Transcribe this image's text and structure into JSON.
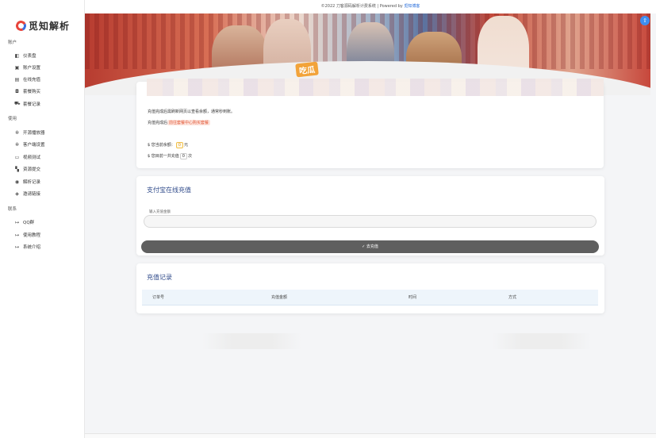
{
  "brand": {
    "name": "觅知解析"
  },
  "topbar": {
    "copyright": "©2022 刀客源码解析计费系统 | Powered by ",
    "powered_link": "觅知博客"
  },
  "sidebar": {
    "groups": [
      {
        "label": "账户",
        "items": [
          {
            "label": "仪表盘",
            "icon": "dashboard-icon",
            "glyph": "◧"
          },
          {
            "label": "账户设置",
            "icon": "user-card-icon",
            "glyph": "▣"
          },
          {
            "label": "在线充值",
            "icon": "card-icon",
            "glyph": "▤"
          },
          {
            "label": "套餐购买",
            "icon": "bag-icon",
            "glyph": "◘"
          },
          {
            "label": "套餐记录",
            "icon": "cart-icon",
            "glyph": "⛟"
          }
        ]
      },
      {
        "label": "使用",
        "items": [
          {
            "label": "开源播放器",
            "icon": "gear-icon",
            "glyph": "✲"
          },
          {
            "label": "客户端设置",
            "icon": "gear-icon",
            "glyph": "✲"
          },
          {
            "label": "视频测试",
            "icon": "monitor-icon",
            "glyph": "▭"
          },
          {
            "label": "资源提交",
            "icon": "book-icon",
            "glyph": "▚"
          },
          {
            "label": "解析记录",
            "icon": "eye-icon",
            "glyph": "◉"
          },
          {
            "label": "邀请链接",
            "icon": "tag-icon",
            "glyph": "◈"
          }
        ]
      },
      {
        "label": "联系",
        "items": [
          {
            "label": "QQ群",
            "icon": "arrow-in-icon",
            "glyph": "↦"
          },
          {
            "label": "使用教程",
            "icon": "arrow-in-icon",
            "glyph": "↦"
          },
          {
            "label": "系统介绍",
            "icon": "arrow-in-icon",
            "glyph": "↦"
          }
        ]
      }
    ]
  },
  "banner": {
    "badge": "吃瓜",
    "accent": "#c7483c"
  },
  "info_card": {
    "line1": "充值完成后需刷新网页以查看余额，通常秒到账。",
    "line2_prefix": "充值完成后",
    "line2_tag": "前往套餐中心购买套餐",
    "balance_prefix": "您当前余额：",
    "balance_value": "0",
    "balance_suffix": "元",
    "count_prefix": "您目前一共充值",
    "count_value": "0",
    "count_suffix": "次",
    "currency_glyph": "$"
  },
  "recharge": {
    "title": "支付宝在线充值",
    "amount_label": "输入充值金额",
    "amount_value": "",
    "submit_label": "✓ 去充值"
  },
  "records": {
    "title": "充值记录",
    "columns": [
      "订单号",
      "充值金额",
      "时间",
      "方式"
    ]
  },
  "colors": {
    "primary": "#2f4a8a",
    "button": "#5f5f5f",
    "link": "#2a6fdb",
    "alert": "#e25b3b"
  }
}
